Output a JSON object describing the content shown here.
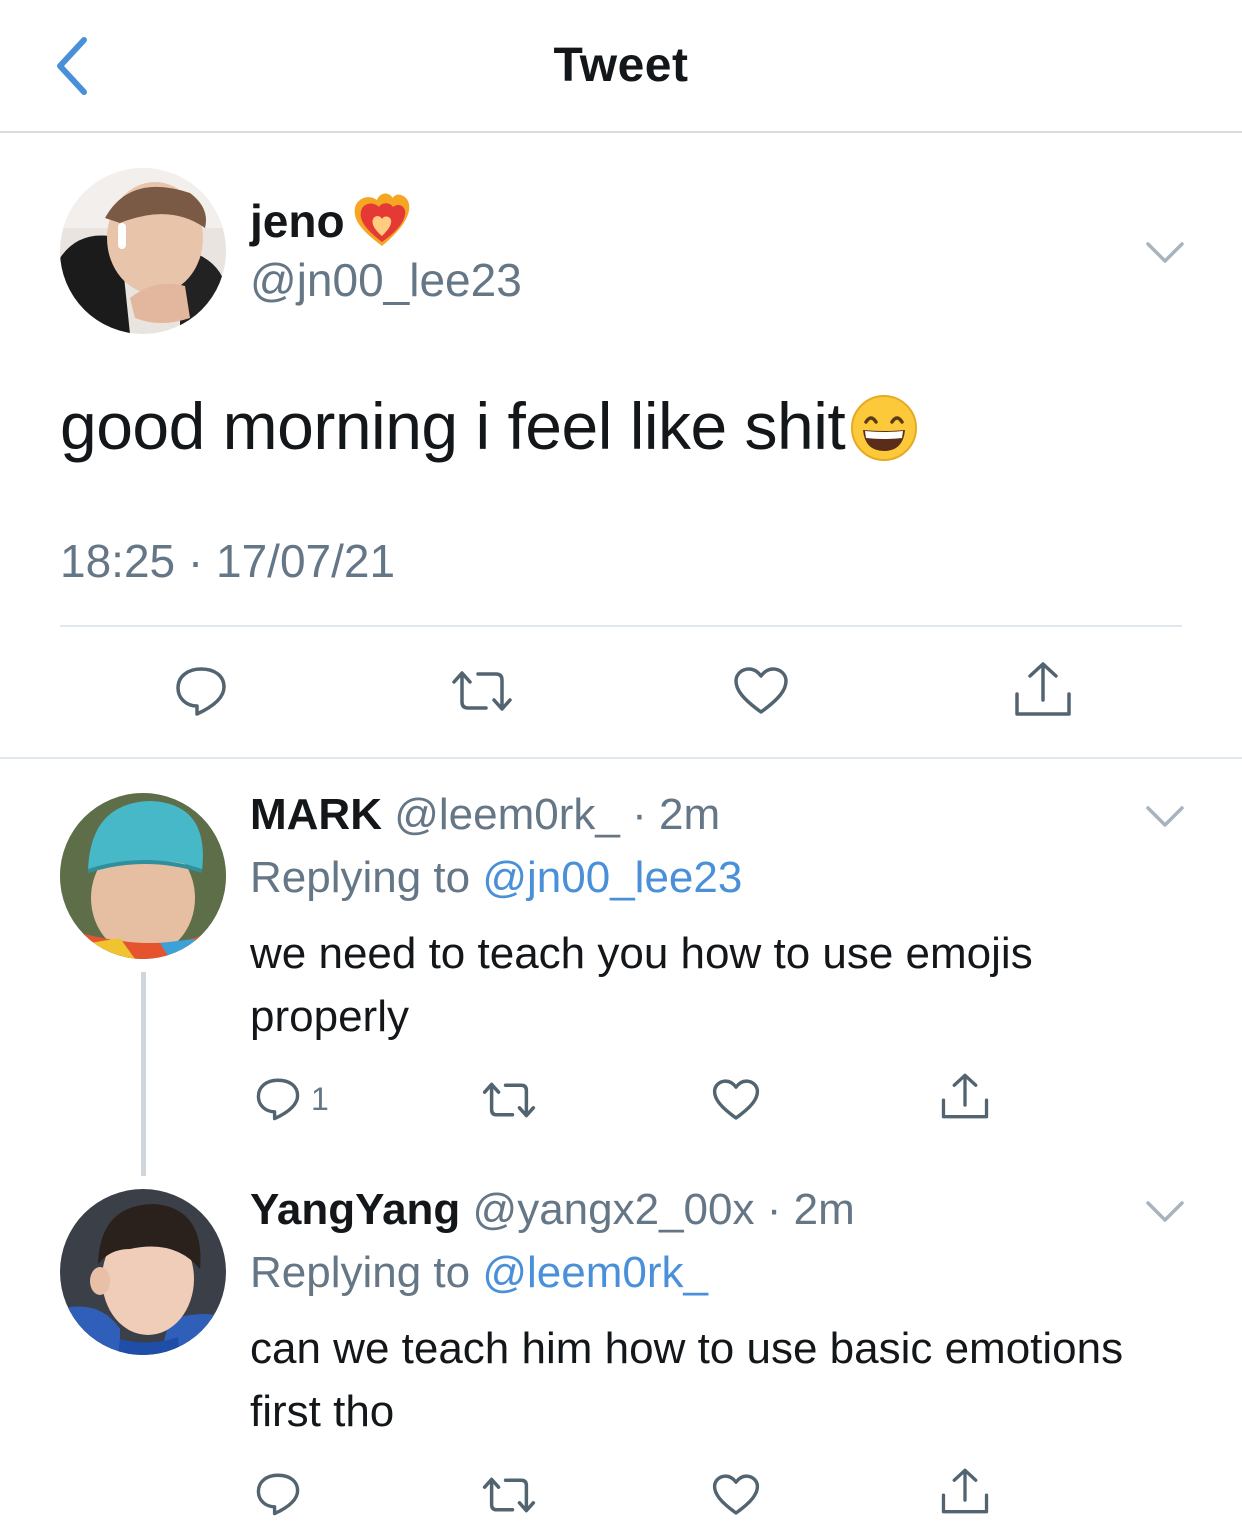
{
  "nav": {
    "title": "Tweet"
  },
  "tweet": {
    "author_name": "jeno",
    "author_handle": "@jn00_lee23",
    "text": "good morning i feel like shit",
    "timestamp": "18:25 · 17/07/21"
  },
  "replies": [
    {
      "name": "MARK",
      "handle": "@leem0rk_",
      "time": "· 2m",
      "replying_prefix": "Replying to ",
      "replying_to": "@jn00_lee23",
      "text": "we need to teach you how to use emojis properly",
      "reply_count": "1"
    },
    {
      "name": "YangYang",
      "handle": "@yangx2_00x",
      "time": "· 2m",
      "replying_prefix": "Replying to ",
      "replying_to": "@leem0rk_",
      "text": "can we teach him how to use basic emotions first tho",
      "reply_count": ""
    }
  ],
  "icons": {
    "back": "chevron-left-icon",
    "more": "chevron-down-icon",
    "reply": "reply-icon",
    "retweet": "retweet-icon",
    "like": "heart-icon",
    "share": "share-icon",
    "name_badge": "heart-on-fire-icon",
    "text_emoji": "grinning-face-icon"
  },
  "colors": {
    "accent": "#4a90d9",
    "secondary_text": "#657786",
    "icon": "#536471",
    "divider": "#e1e8ed"
  }
}
